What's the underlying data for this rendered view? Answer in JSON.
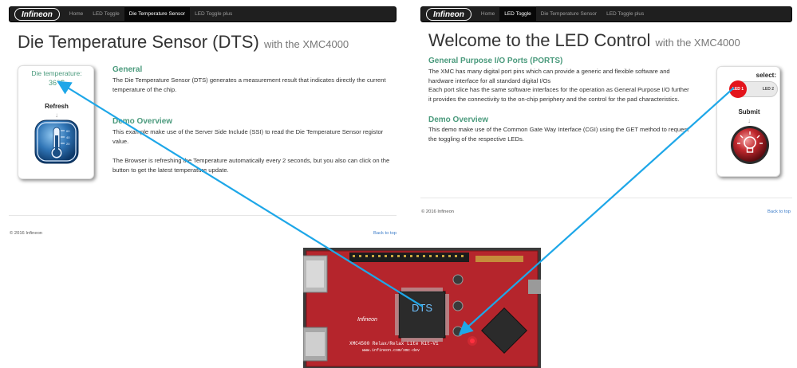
{
  "left_panel": {
    "nav": {
      "logo": "Infineon",
      "items": [
        "Home",
        "LED Toggle",
        "Die Temperature Sensor",
        "LED Toggle plus"
      ],
      "active_index": 2
    },
    "title": "Die Temperature Sensor (DTS)",
    "title_sub": "with the XMC4000",
    "card": {
      "temp_label": "Die temperature:",
      "temp_value": "36℃",
      "refresh_label": "Refresh",
      "arrow": "↓",
      "thermo_labels": [
        "60",
        "40",
        "20"
      ]
    },
    "section1_title": "General",
    "section1_text": "The Die Temperature Sensor (DTS) generates a measurement result that indicates directly the current temperature of the chip.",
    "section2_title": "Demo Overview",
    "section2_text1": "This example make use of the Server Side Include (SSI) to read the Die Temperature Sensor registor value.",
    "section2_text2": "The Browser is refreshing the Temperature automatically every 2 seconds, but you also can click on the button to get the latest temperature update.",
    "footer_left": "© 2016 Infineon",
    "footer_right": "Back to top"
  },
  "right_panel": {
    "nav": {
      "logo": "Infineon",
      "items": [
        "Home",
        "LED Toggle",
        "Die Temperature Sensor",
        "LED Toggle plus"
      ],
      "active_index": 1
    },
    "title": "Welcome to the LED Control",
    "title_sub": "with the XMC4000",
    "section1_title": "General Purpose I/O Ports (PORTS)",
    "section1_text": "The XMC has many digital port pins which can provide a generic and flexible software and hardware interface for all standard digital I/Os",
    "section1_text2": "Each port slice has the same software interfaces for the operation as General Purpose I/O further it provides the connectivity to the on-chip periphery and the control for the pad characteristics.",
    "section2_title": "Demo Overview",
    "section2_text": "This demo make use of the Common Gate Way Interface (CGI) using the GET method to request the toggling of the respective LEDs.",
    "card": {
      "select_label": "select:",
      "led1": "LED 1",
      "led2": "LED 2",
      "submit_label": "Submit",
      "arrow": "↓"
    },
    "footer_left": "© 2016 Infineon",
    "footer_right": "Back to top"
  },
  "board": {
    "dts_label": "DTS",
    "brand": "Infineon",
    "silk_line1": "XMC4500 Relax/Relax Lite Kit-V1",
    "silk_line2": "www.infineon.com/xmc-dev",
    "colors": {
      "pcb": "#b5252c",
      "chip": "#2b2b2b",
      "arrow": "#1ea7e8"
    }
  }
}
